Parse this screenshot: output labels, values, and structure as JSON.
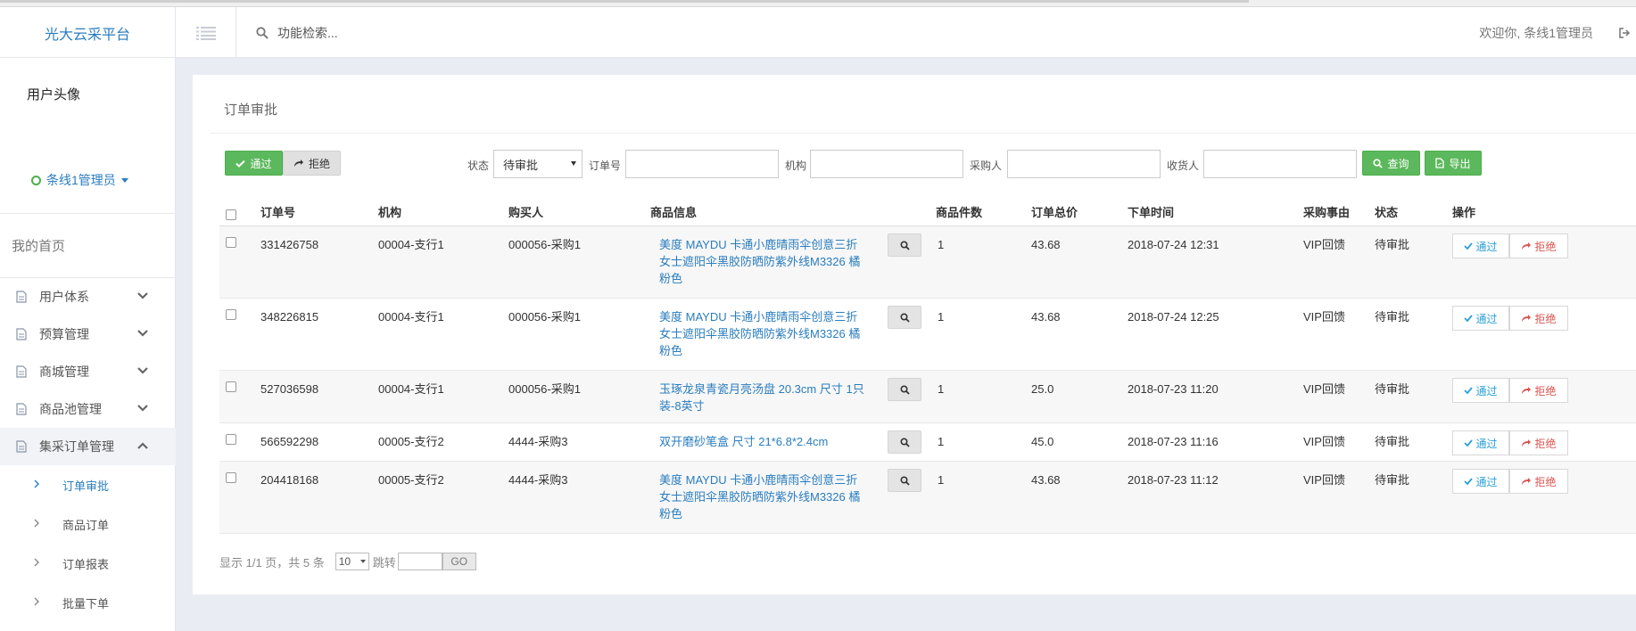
{
  "header": {
    "brand": "光大云采平台",
    "search_placeholder": "功能检索...",
    "welcome": "欢迎你, 条线1管理员"
  },
  "sidebar": {
    "avatar_text": "用户头像",
    "user_name": "条线1管理员",
    "home": "我的首页",
    "items": [
      {
        "label": "用户体系"
      },
      {
        "label": "预算管理"
      },
      {
        "label": "商城管理"
      },
      {
        "label": "商品池管理"
      },
      {
        "label": "集采订单管理"
      }
    ],
    "subitems": [
      {
        "label": "订单审批"
      },
      {
        "label": "商品订单"
      },
      {
        "label": "订单报表"
      },
      {
        "label": "批量下单"
      }
    ]
  },
  "panel": {
    "title": "订单审批",
    "approve_label": "通过",
    "reject_label": "拒绝",
    "filters": {
      "status_label": "状态",
      "status_value": "待审批",
      "order_no_label": "订单号",
      "org_label": "机构",
      "buyer_label": "采购人",
      "receiver_label": "收货人"
    },
    "query_label": "查询",
    "export_label": "导出"
  },
  "table": {
    "headers": [
      "订单号",
      "机构",
      "购买人",
      "商品信息",
      "商品件数",
      "订单总价",
      "下单时间",
      "采购事由",
      "状态",
      "操作"
    ],
    "action_approve": "通过",
    "action_reject": "拒绝",
    "rows": [
      {
        "order_no": "331426758",
        "org": "00004-支行1",
        "buyer": "000056-采购1",
        "product": "美度 MAYDU 卡通小鹿晴雨伞创意三折女士遮阳伞黑胶防晒防紫外线M3326 橘粉色",
        "qty": "1",
        "total": "43.68",
        "time": "2018-07-24 12:31",
        "reason": "VIP回馈",
        "status": "待审批"
      },
      {
        "order_no": "348226815",
        "org": "00004-支行1",
        "buyer": "000056-采购1",
        "product": "美度 MAYDU 卡通小鹿晴雨伞创意三折女士遮阳伞黑胶防晒防紫外线M3326 橘粉色",
        "qty": "1",
        "total": "43.68",
        "time": "2018-07-24 12:25",
        "reason": "VIP回馈",
        "status": "待审批"
      },
      {
        "order_no": "527036598",
        "org": "00004-支行1",
        "buyer": "000056-采购1",
        "product": "玉琢龙泉青瓷月亮汤盘 20.3cm 尺寸 1只装-8英寸",
        "qty": "1",
        "total": "25.0",
        "time": "2018-07-23 11:20",
        "reason": "VIP回馈",
        "status": "待审批"
      },
      {
        "order_no": "566592298",
        "org": "00005-支行2",
        "buyer": "4444-采购3",
        "product": "双开磨砂笔盒 尺寸 21*6.8*2.4cm",
        "qty": "1",
        "total": "45.0",
        "time": "2018-07-23 11:16",
        "reason": "VIP回馈",
        "status": "待审批"
      },
      {
        "order_no": "204418168",
        "org": "00005-支行2",
        "buyer": "4444-采购3",
        "product": "美度 MAYDU 卡通小鹿晴雨伞创意三折女士遮阳伞黑胶防晒防紫外线M3326 橘粉色",
        "qty": "1",
        "total": "43.68",
        "time": "2018-07-23 11:12",
        "reason": "VIP回馈",
        "status": "待审批"
      }
    ]
  },
  "pager": {
    "info": "显示 1/1 页，共 5 条",
    "page_size": "10",
    "jump_label": "跳转",
    "go_label": "GO"
  },
  "colors": {
    "accent": "#2a7dbf",
    "green": "#5cb85c",
    "danger": "#d9534f"
  }
}
